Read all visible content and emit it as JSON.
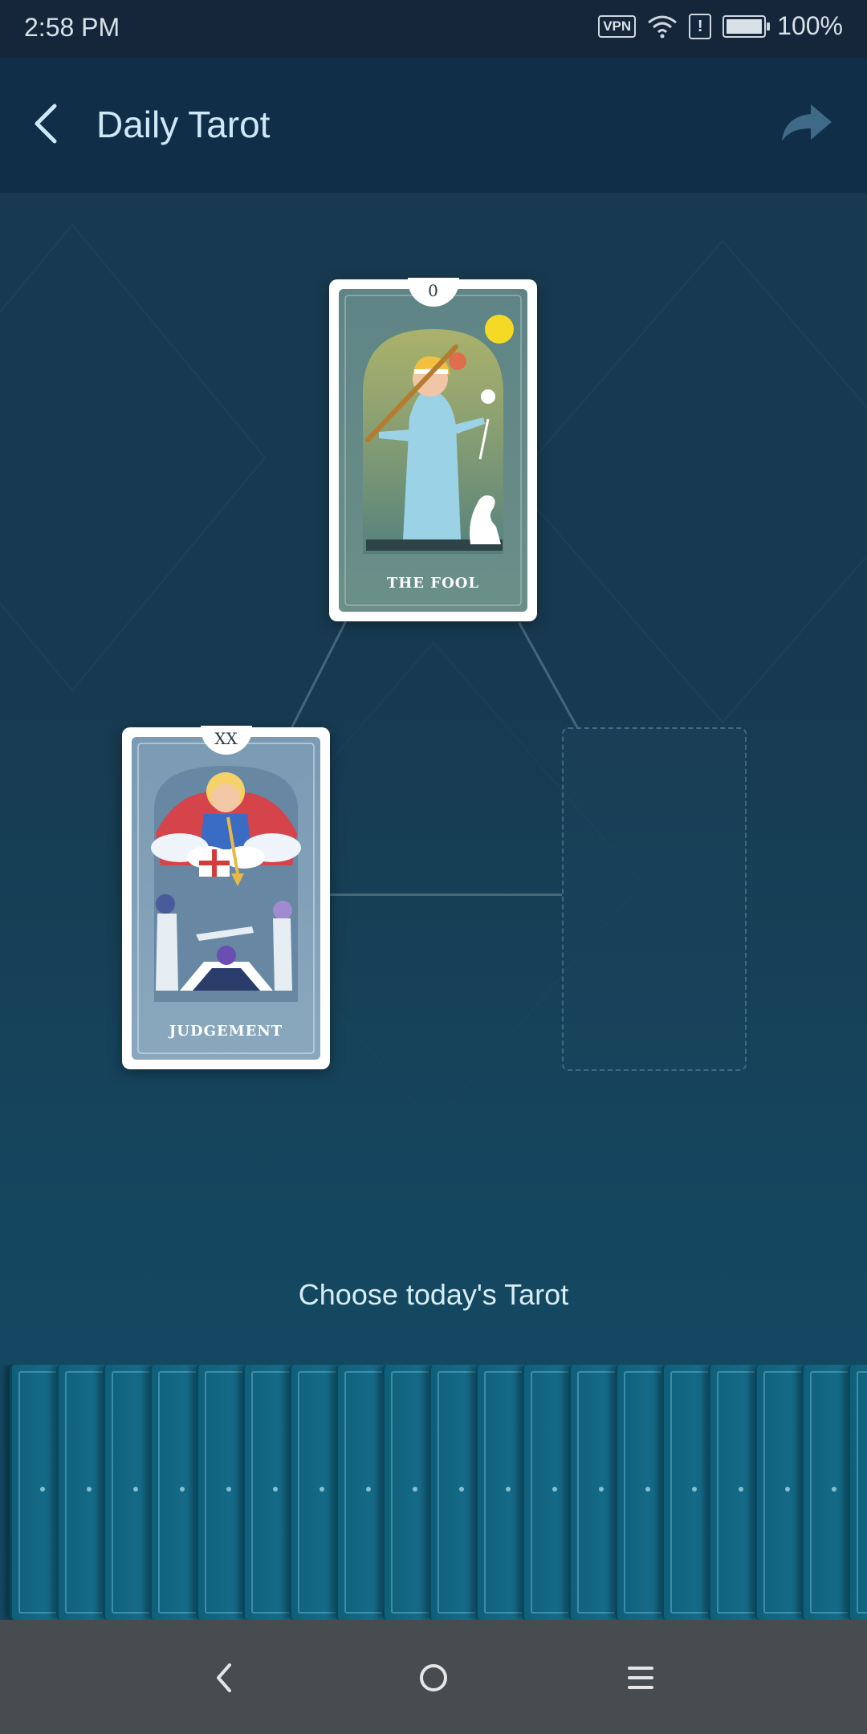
{
  "status": {
    "time": "2:58 PM",
    "vpn_label": "VPN",
    "alert_label": "!",
    "battery": "100%",
    "battery_level": 1.0
  },
  "appbar": {
    "title": "Daily Tarot",
    "back_icon": "chevron-left-icon",
    "share_icon": "share-arrow-icon"
  },
  "cards": {
    "top": {
      "number": "0",
      "name": "THE FOOL"
    },
    "left": {
      "number": "XX",
      "name": "JUDGEMENT"
    },
    "right": {
      "state": "empty"
    }
  },
  "prompt": "Choose today's Tarot",
  "deck": {
    "count": 19
  },
  "navbar": {
    "back_icon": "triangle-back-icon",
    "home_icon": "circle-home-icon",
    "menu_icon": "hamburger-menu-icon"
  },
  "colors": {
    "appbar": "#112e48",
    "card_back": "#1a7595",
    "navbar": "#474c51"
  }
}
